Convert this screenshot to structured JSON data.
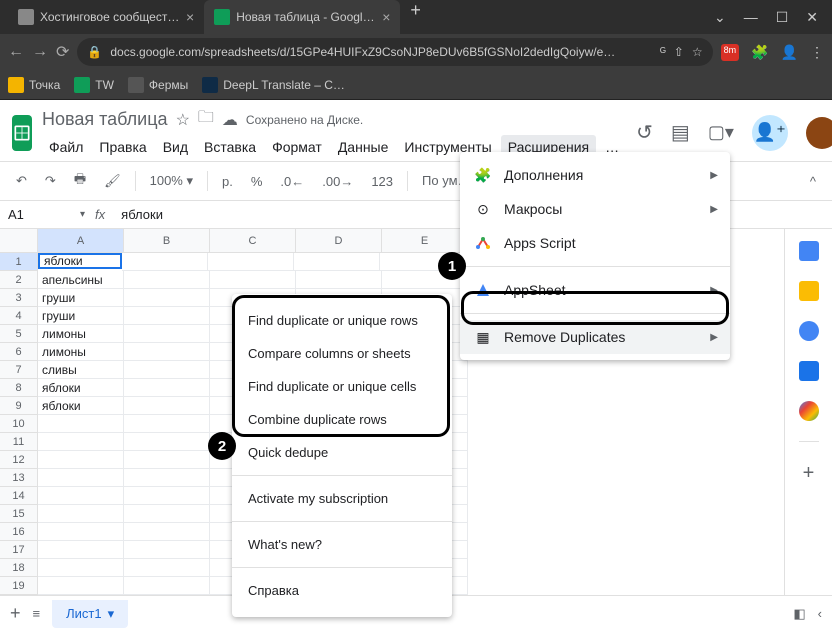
{
  "browser": {
    "tabs": [
      {
        "title": "Хостинговое сообщество «Tim…"
      },
      {
        "title": "Новая таблица - Google Табли…"
      }
    ],
    "url": "docs.google.com/spreadsheets/d/15GPe4HUIFxZ9CsoNJP8eDUv6B5fGSNoI2dedIgQoiyw/e…",
    "bookmarks": [
      "Точка",
      "TW",
      "Фермы",
      "DeepL Translate – С…"
    ],
    "ext_badge": "8m"
  },
  "sheets": {
    "title": "Новая таблица",
    "saved": "Сохранено на Диске.",
    "menus": [
      "Файл",
      "Правка",
      "Вид",
      "Вставка",
      "Формат",
      "Данные",
      "Инструменты",
      "Расширения",
      "…"
    ],
    "toolbar": {
      "zoom": "100%",
      "currency": "р.",
      "percent": "%",
      "dec_dec": ".0",
      "inc_dec": ".00",
      "num_format": "123",
      "font": "По ум…"
    },
    "name_box": "A1",
    "formula": "яблоки",
    "cols": [
      "A",
      "B",
      "C",
      "D",
      "E"
    ],
    "rows": [
      "1",
      "2",
      "3",
      "4",
      "5",
      "6",
      "7",
      "8",
      "9",
      "10",
      "11",
      "12",
      "13",
      "14",
      "15",
      "16",
      "17",
      "18",
      "19"
    ],
    "data": [
      "яблоки",
      "апельсины",
      "груши",
      "груши",
      "лимоны",
      "лимоны",
      "сливы",
      "яблоки",
      "яблоки"
    ],
    "sheet_tab": "Лист1"
  },
  "ext_menu": {
    "items": [
      {
        "label": "Дополнения",
        "icon": "puzzle"
      },
      {
        "label": "Макросы",
        "icon": "macro"
      },
      {
        "label": "Apps Script",
        "icon": "script"
      },
      {
        "label": "AppSheet",
        "icon": "appsheet"
      },
      {
        "label": "Remove Duplicates",
        "icon": "rd"
      }
    ]
  },
  "submenu": {
    "top": [
      "Find duplicate or unique rows",
      "Compare columns or sheets",
      "Find duplicate or unique cells",
      "Combine duplicate rows",
      "Quick dedupe"
    ],
    "bottom": [
      "Activate my subscription",
      "What's new?",
      "Справка"
    ]
  },
  "callouts": {
    "one": "1",
    "two": "2"
  }
}
